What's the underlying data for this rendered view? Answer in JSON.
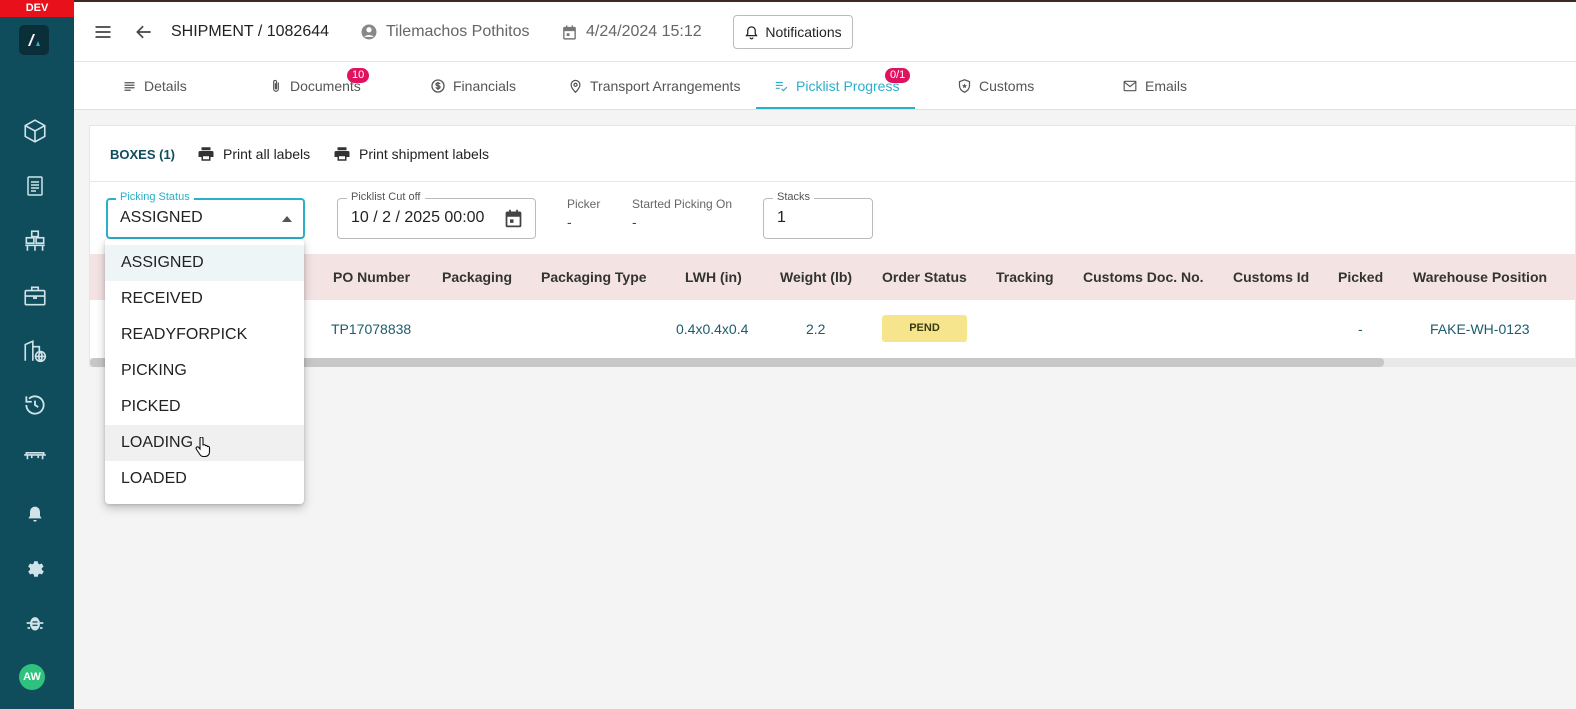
{
  "env_badge": "DEV",
  "user": {
    "initials": "AW"
  },
  "header": {
    "shipment_title": "SHIPMENT / 1082644",
    "owner": "Tilemachos Pothitos",
    "datetime": "4/24/2024 15:12",
    "notifications_label": "Notifications"
  },
  "tabs": [
    {
      "label": "Details"
    },
    {
      "label": "Documents",
      "badge": "10"
    },
    {
      "label": "Financials"
    },
    {
      "label": "Transport Arrangements"
    },
    {
      "label": "Picklist Progress",
      "badge": "0/1",
      "active": true
    },
    {
      "label": "Customs"
    },
    {
      "label": "Emails"
    }
  ],
  "card": {
    "boxes_label": "BOXES (1)",
    "print_all_label": "Print all labels",
    "print_shipment_label": "Print shipment labels",
    "picking_status": {
      "label": "Picking Status",
      "value": "ASSIGNED"
    },
    "cutoff": {
      "label": "Picklist Cut off",
      "value": "10 / 2 / 2025 00:00"
    },
    "picker": {
      "label": "Picker",
      "value": "-"
    },
    "started": {
      "label": "Started Picking On",
      "value": "-"
    },
    "stacks": {
      "label": "Stacks",
      "value": "1"
    }
  },
  "table": {
    "columns": [
      "PO Number",
      "Packaging",
      "Packaging Type",
      "LWH (in)",
      "Weight (lb)",
      "Order Status",
      "Tracking",
      "Customs Doc. No.",
      "Customs Id",
      "Picked",
      "Warehouse Position"
    ],
    "rows": [
      {
        "po_number": "TP17078838",
        "packaging": "",
        "packaging_type": "",
        "lwh": "0.4x0.4x0.4",
        "weight": "2.2",
        "order_status": "PEND",
        "tracking": "",
        "customs_doc": "",
        "customs_id": "",
        "picked": "-",
        "warehouse_position": "FAKE-WH-0123"
      }
    ]
  },
  "dropdown": {
    "options": [
      "ASSIGNED",
      "RECEIVED",
      "READYFORPICK",
      "PICKING",
      "PICKED",
      "LOADING",
      "LOADED"
    ],
    "selected": "ASSIGNED",
    "hovered": "LOADING"
  },
  "colors": {
    "sidebar": "#0f4c5c",
    "accent": "#2ab0c9",
    "badge": "#e0115f",
    "status_pend": "#f6e58d",
    "dev": "#e8111b"
  }
}
